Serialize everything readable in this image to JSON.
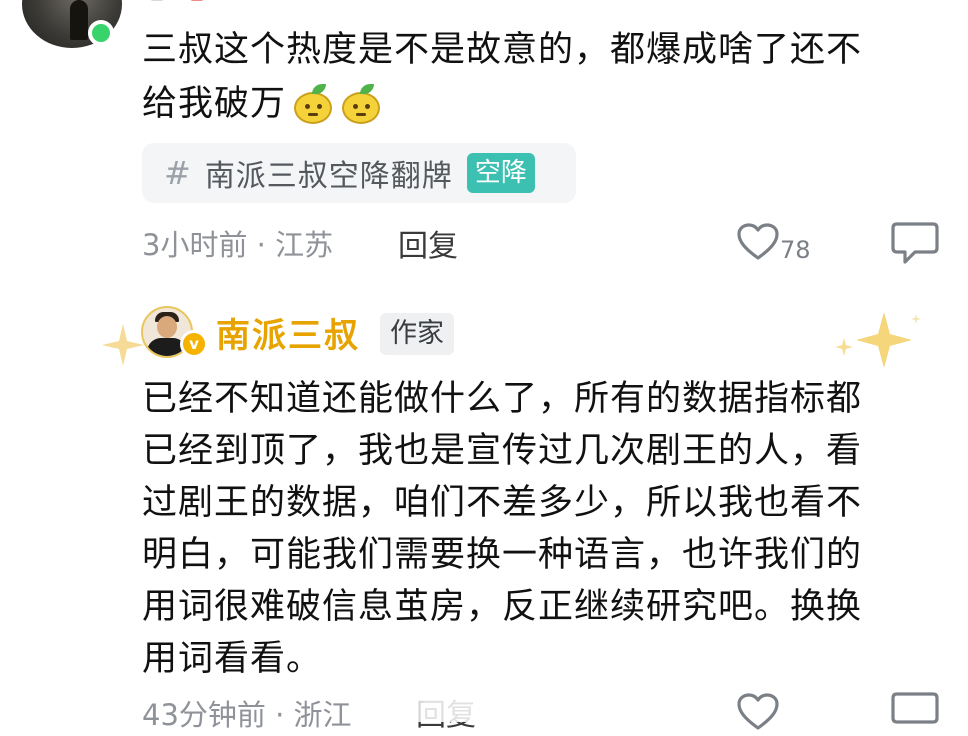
{
  "comment1": {
    "text_line1": "三叔这个热度是不是故意的，都爆成啥了还不",
    "text_line2": "给我破万",
    "emoji_name": "lemon-emoji",
    "topic": {
      "hash": "#",
      "label": "南派三叔空降翻牌",
      "badge": "空降"
    },
    "meta": "3小时前 · 江苏",
    "reply_label": "回复",
    "likes": "78"
  },
  "comment2": {
    "author_name": "南派三叔",
    "verified_badge": "v",
    "author_tag": "作家",
    "body_lines": [
      "已经不知道还能做什么了，所有的数据指标都",
      "已经到顶了，我也是宣传过几次剧王的人，看",
      "过剧王的数据，咱们不差多少，所以我也看不",
      "明白，可能我们需要换一种语言，也许我们的",
      "用词很难破信息茧房，反正继续研究吧。换换",
      "用词看看。"
    ],
    "meta": "43分钟前 · 浙江",
    "reply_label": "回复"
  },
  "colors": {
    "author_gold": "#e7a300",
    "topic_badge": "#3bc0b2",
    "online_dot": "#39d36b",
    "meta_gray": "#8f9399"
  },
  "icons": [
    "lemon-emoji",
    "heart-icon",
    "comment-bubble-icon",
    "sparkle-icon",
    "verified-badge-icon"
  ]
}
